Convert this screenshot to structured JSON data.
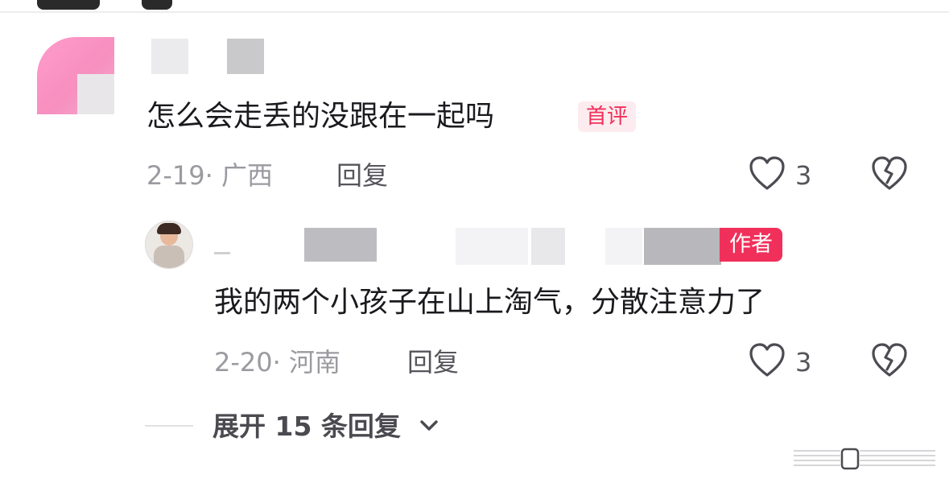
{
  "comment": {
    "text": "怎么会走丢的没跟在一起吗",
    "badge": "首评",
    "date_location": "2-19· 广西",
    "reply_label": "回复",
    "like_count": "3"
  },
  "reply": {
    "author_badge": "作者",
    "text": "我的两个小孩子在山上淘气，分散注意力了",
    "date_location": "2-20· 河南",
    "reply_label": "回复",
    "like_count": "3"
  },
  "expand_label": "展开 15 条回复",
  "colors": {
    "accent": "#f0305a",
    "badge_bg": "#fdecef",
    "meta_text": "#9a9aa0"
  },
  "icons": [
    "heart-outline-icon",
    "broken-heart-icon",
    "chevron-down-icon"
  ]
}
